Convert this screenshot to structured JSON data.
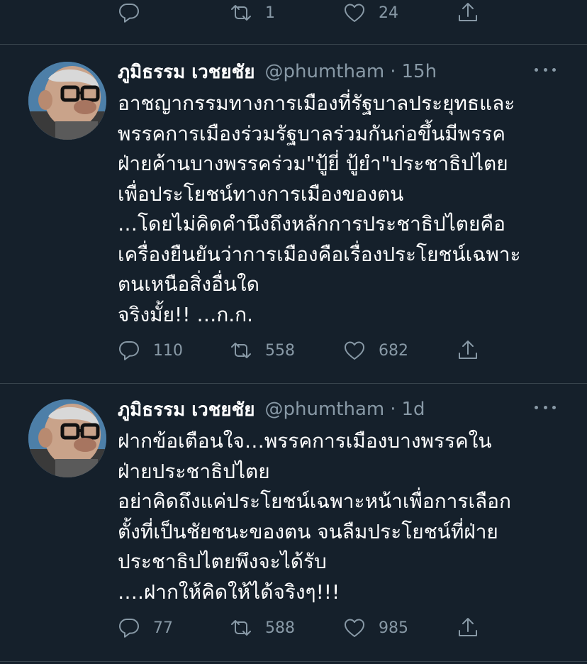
{
  "top_actions": {
    "reply": "",
    "retweet": "1",
    "like": "24"
  },
  "tweets": [
    {
      "name": "ภูมิธรรม เวชยชัย",
      "handle": "@phumtham",
      "separator": "·",
      "time": "15h",
      "text": "อาชญากรรมทางการเมืองที่รัฐบาลประยุทธและ\nพรรคการเมืองร่วมรัฐบาลร่วมกันก่อขึ้นมีพรรค\nฝ่ายค้านบางพรรคร่วม\"ปู้ยี่ ปู้ยำ\"ประชาธิปไตย\nเพื่อประโยชน์ทางการเมืองของตน\n…โดยไม่คิดคำนึงถึงหลักการประชาธิปไตยคือ\nเครื่องยืนยันว่าการเมืองคือเรื่องประโยชน์เฉพาะ\nตนเหนือสิ่งอื่นใด\nจริงมั้ย!! …ก.ก.",
      "replies": "110",
      "retweets": "558",
      "likes": "682"
    },
    {
      "name": "ภูมิธรรม เวชยชัย",
      "handle": "@phumtham",
      "separator": "·",
      "time": "1d",
      "text": "ฝากข้อเตือนใจ…พรรคการเมืองบางพรรคใน\nฝ่ายประชาธิปไตย\nอย่าคิดถึงแค่ประโยชน์เฉพาะหน้าเพื่อการเลือก\nตั้งที่เป็นชัยชนะของตน จนลืมประโยชน์ที่ฝ่าย\nประชาธิปไตยพึงจะได้รับ\n….ฝากให้คิดให้ได้จริงๆ!!!",
      "replies": "77",
      "retweets": "588",
      "likes": "985"
    }
  ],
  "colors": {
    "background": "#15202b",
    "divider": "#38444d",
    "secondary_text": "#8899a6",
    "primary_text": "#ffffff"
  },
  "icons": [
    "reply-icon",
    "retweet-icon",
    "like-icon",
    "share-icon",
    "more-icon"
  ]
}
